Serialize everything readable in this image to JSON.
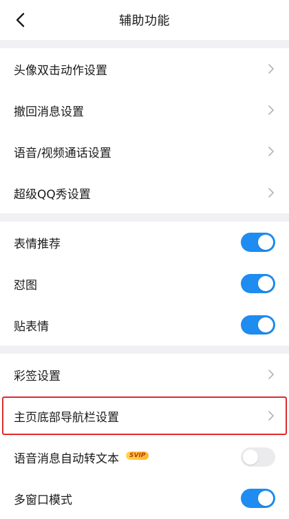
{
  "header": {
    "title": "辅助功能"
  },
  "group1": [
    {
      "label": "头像双击动作设置"
    },
    {
      "label": "撤回消息设置"
    },
    {
      "label": "语音/视频通话设置"
    },
    {
      "label": "超级QQ秀设置"
    }
  ],
  "group2": [
    {
      "label": "表情推荐",
      "state": "on"
    },
    {
      "label": "怼图",
      "state": "on"
    },
    {
      "label": "贴表情",
      "state": "on"
    }
  ],
  "group3": [
    {
      "label": "彩签设置"
    },
    {
      "label": "主页底部导航栏设置"
    },
    {
      "label": "语音消息自动转文本",
      "badge": "SVIP",
      "state": "off"
    },
    {
      "label": "多窗口模式",
      "state": "on"
    }
  ],
  "colors": {
    "accent": "#1e8cf0",
    "highlight": "#e02828",
    "background": "#f1f1f4"
  }
}
